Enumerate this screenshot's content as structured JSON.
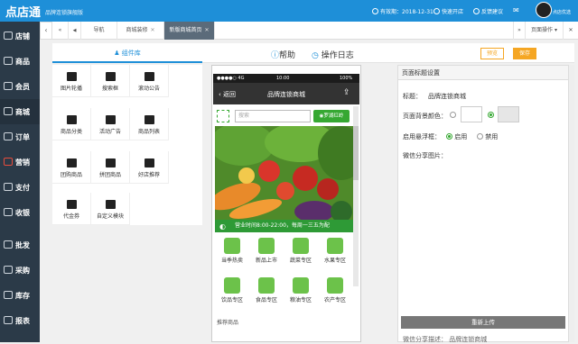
{
  "topbar": {
    "logo": "点店通",
    "edition": "品牌连锁旗舰版",
    "expiry": "有效期：2018-12-31",
    "quick_store": "快速开店",
    "feedback": "反馈建议",
    "shop_name": "点店优选"
  },
  "sidebar": {
    "items": [
      {
        "label": "店铺",
        "icon": "store-icon"
      },
      {
        "label": "商品",
        "icon": "goods-icon"
      },
      {
        "label": "会员",
        "icon": "member-icon"
      },
      {
        "label": "商城",
        "icon": "mall-icon"
      },
      {
        "label": "订单",
        "icon": "order-icon"
      },
      {
        "label": "营销",
        "icon": "marketing-icon"
      },
      {
        "label": "支付",
        "icon": "payment-icon"
      },
      {
        "label": "收银",
        "icon": "cashier-icon"
      },
      {
        "label": "批发",
        "icon": "wholesale-icon"
      },
      {
        "label": "采购",
        "icon": "purchase-icon"
      },
      {
        "label": "库存",
        "icon": "stock-icon"
      },
      {
        "label": "报表",
        "icon": "report-icon"
      }
    ]
  },
  "tabs": {
    "prev": "«",
    "home_icon": "◀",
    "tab1": "导航",
    "tab2": "商城装修",
    "tab3": "新版商城首页",
    "next": "»",
    "page_ops": "页面操作"
  },
  "toolbar": {
    "component_lib": "组件库",
    "help": "帮助",
    "oplog": "操作日志",
    "preview": "预览",
    "save": "保存"
  },
  "components": [
    {
      "label": "图片轮播",
      "icon": "carousel-icon"
    },
    {
      "label": "搜索框",
      "icon": "search-box-icon"
    },
    {
      "label": "滚动公告",
      "icon": "announcement-icon"
    },
    {
      "label": "商品分类",
      "icon": "image-category-icon"
    },
    {
      "label": "活动广告",
      "icon": "ad-icon"
    },
    {
      "label": "商品列表",
      "icon": "product-list-icon"
    },
    {
      "label": "团购商品",
      "icon": "group-buy-icon"
    },
    {
      "label": "拼团商品",
      "icon": "pin-group-icon"
    },
    {
      "label": "好店推荐",
      "icon": "store-recommend-icon"
    },
    {
      "label": "代金券",
      "icon": "coupon-icon"
    },
    {
      "label": "自定义模块",
      "icon": "custom-module-icon"
    }
  ],
  "phone": {
    "carrier": "●●●●○ 4G",
    "time": "10:00",
    "battery": "100%",
    "back": "返回",
    "title": "品牌连锁商城",
    "search_placeholder": "搜索",
    "store_button": "罗湖红岭",
    "hours": "营业时间8:00-22:00，每周一三五为配",
    "categories": [
      "当季热卖",
      "新品上市",
      "蔬菜专区",
      "水果专区",
      "饮品专区",
      "食品专区",
      "粮油专区",
      "农产专区"
    ],
    "recommend": "推荐商品"
  },
  "panel": {
    "header": "页面标题设置",
    "title_label": "标题：",
    "title_value": "品牌连锁商城",
    "bg_label": "页面背景颜色：",
    "float_label": "启用悬浮框：",
    "enable": "启用",
    "disable": "禁用",
    "share_label": "微信分享图片：",
    "reupload": "重新上传",
    "desc": "微信分享描述：   品牌连锁商城"
  },
  "colors": {
    "topbar": "#1e8fd8",
    "sidebar": "#2b3a48",
    "accent_orange": "#f5a623",
    "green": "#36a832"
  }
}
